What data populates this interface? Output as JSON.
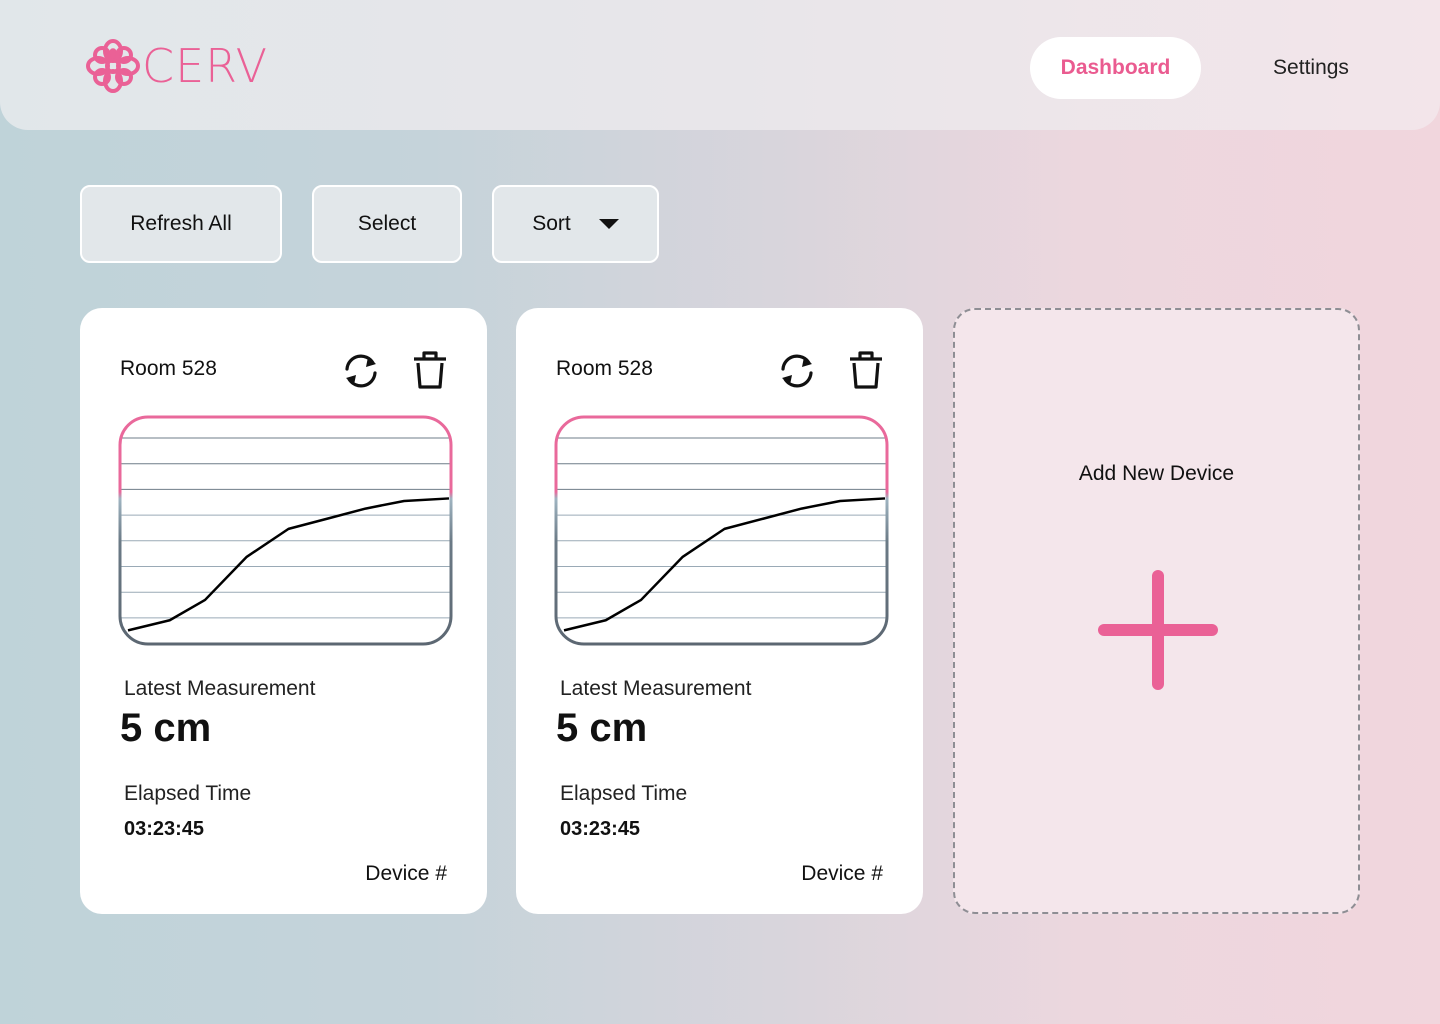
{
  "brand": {
    "name": "CERV",
    "accent": "#ea5b90"
  },
  "nav": {
    "dashboard": "Dashboard",
    "settings": "Settings"
  },
  "toolbar": {
    "refresh_all": "Refresh All",
    "select": "Select",
    "sort": "Sort"
  },
  "icons": {
    "refresh": "refresh-icon",
    "trash": "trash-icon",
    "plus": "plus-icon",
    "logo": "flower-icon",
    "sort": "caret-down-icon"
  },
  "devices": [
    {
      "room": "Room 528",
      "latest_label": "Latest Measurement",
      "latest_value": "5 cm",
      "elapsed_label": "Elapsed Time",
      "elapsed_value": "03:23:45",
      "device": "Device #"
    },
    {
      "room": "Room 528",
      "latest_label": "Latest Measurement",
      "latest_value": "5 cm",
      "elapsed_label": "Elapsed Time",
      "elapsed_value": "03:23:45",
      "device": "Device #"
    }
  ],
  "add_device": {
    "label": "Add New Device"
  },
  "chart_data": {
    "type": "line",
    "ylim": [
      0,
      8
    ],
    "grid": true,
    "values": [
      0.3,
      0.7,
      1.5,
      3.2,
      4.3,
      4.7,
      5.1,
      5.4,
      5.5
    ]
  }
}
